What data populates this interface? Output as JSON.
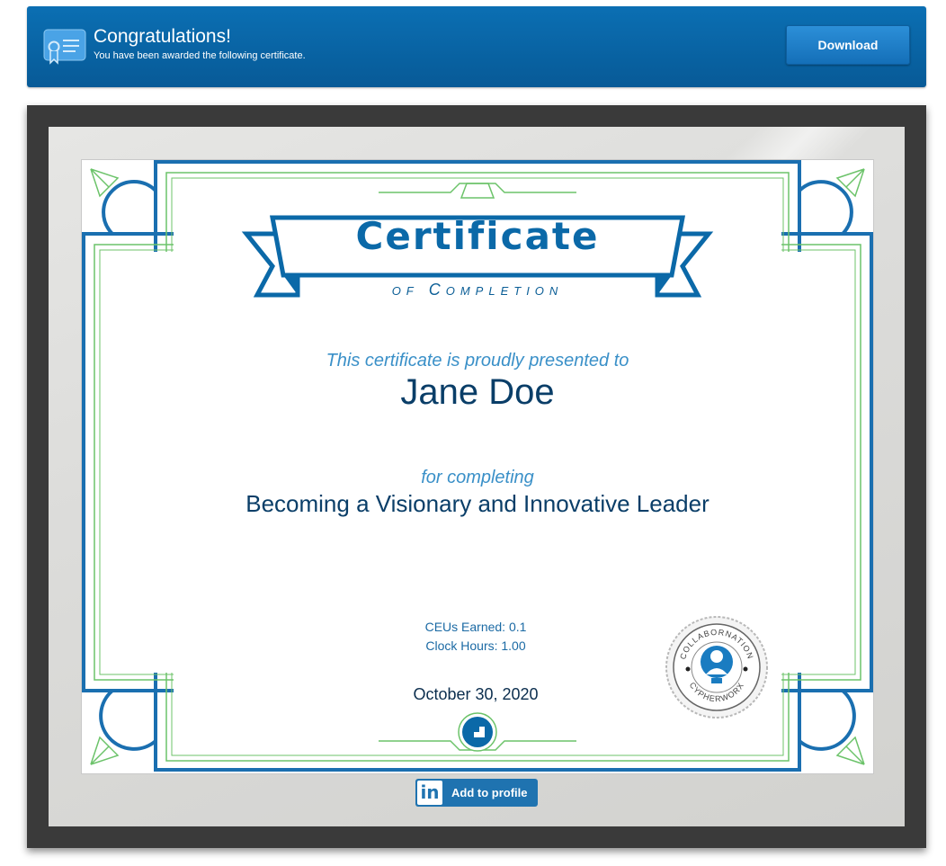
{
  "banner": {
    "title": "Congratulations!",
    "subtitle": "You have been awarded the following certificate.",
    "icon": "certificate-icon",
    "download_label": "Download"
  },
  "certificate": {
    "heading": "Certificate",
    "subheading": "of Completion",
    "presented_text": "This certificate is proudly presented to",
    "recipient": "Jane Doe",
    "for_text": "for completing",
    "course": "Becoming a Visionary and Innovative Leader",
    "ceus": "CEUs Earned: 0.1",
    "clock_hours": "Clock Hours: 1.00",
    "date": "October 30, 2020",
    "seal_top_text": "COLLABORNATION",
    "seal_bottom_text": "CYPHERWORX"
  },
  "linkedin": {
    "mark": "in",
    "label": "Add to profile"
  },
  "colors": {
    "banner": "#0b6fb3",
    "cert_blue": "#0b69a8",
    "border_blue": "#1a6fb0",
    "border_green": "#6cc36a",
    "frame": "#3a3a3a",
    "linkedin": "#1f73b0"
  }
}
